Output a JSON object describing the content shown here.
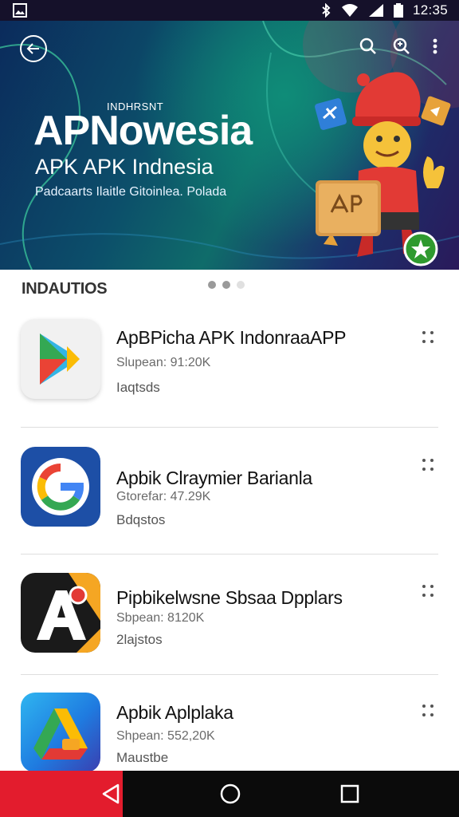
{
  "status_bar": {
    "time": "12:35",
    "icons": [
      "image-icon",
      "bluetooth-icon",
      "wifi-icon",
      "signal-icon",
      "battery-icon"
    ]
  },
  "banner": {
    "eyebrow": "INDHRSNT",
    "title": "APNowesia",
    "subtitle": "APK APK Indnesia",
    "tagline": "Padcaarts Ilaitle Gitoinlea. Polada",
    "colors": {
      "bg_dark": "#0b2b5c",
      "bg_teal": "#0f8c78",
      "mascot_red": "#e23a35",
      "badge_green": "#2f9a2f"
    }
  },
  "toolbar": {
    "back_icon": "back-arrow-icon",
    "search_icon": "search-icon",
    "search_alt_icon": "search-alt-icon",
    "menu_icon": "more-vert-icon"
  },
  "section": {
    "title": "INDAUTIOS",
    "carousel_dots": 3,
    "active_dot": 1
  },
  "apps": [
    {
      "name": "ApBPicha APK IndonraaAPP",
      "size": "Slupean: 91:20K",
      "meta": "Iaqtsds",
      "icon": "play-store-icon"
    },
    {
      "name": "Apbik Clraymier Barianla",
      "size": "Gtorefar: 47.29K",
      "meta": "Bdqstos",
      "icon": "google-g-icon"
    },
    {
      "name": "Pipbikelwsne Sbsaa Dpplars",
      "size": "Sbpean: 8120K",
      "meta": "2lajstos",
      "icon": "a-letter-app-icon"
    },
    {
      "name": "Apbik Aplplaka",
      "size": "Shpean: 552,20K",
      "meta": "Maustbe",
      "icon": "drive-like-icon"
    }
  ],
  "nav_bar": {
    "back_icon": "nav-back-icon",
    "home_icon": "nav-home-icon",
    "recents_icon": "nav-recents-icon",
    "accent": "#e31c2d"
  }
}
